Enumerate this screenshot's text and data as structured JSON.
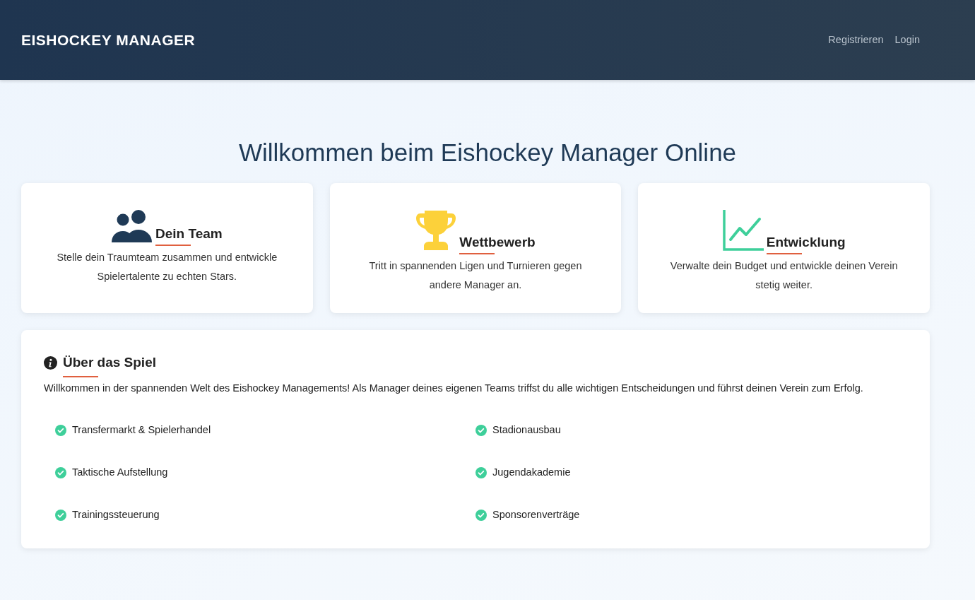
{
  "navbar": {
    "brand": "EISHOCKEY MANAGER",
    "links": [
      "Registrieren",
      "Login"
    ]
  },
  "hero": {
    "title": "Willkommen beim Eishockey Manager Online"
  },
  "features": [
    {
      "kind": "team",
      "title": "Dein Team",
      "text": "Stelle dein Traumteam zusammen und entwickle Spielertalente zu echten Stars."
    },
    {
      "kind": "trophy",
      "title": "Wettbewerb",
      "text": "Tritt in spannenden Ligen und Turnieren gegen andere Manager an."
    },
    {
      "kind": "chart",
      "title": "Entwicklung",
      "text": "Verwalte dein Budget und entwickle deinen Verein stetig weiter."
    }
  ],
  "about": {
    "title": "Über das Spiel",
    "text": "Willkommen in der spannenden Welt des Eishockey Managements! Als Manager deines eigenen Teams triffst du alle wichtigen Entscheidungen und führst deinen Verein zum Erfolg.",
    "items": [
      "Transfermarkt & Spielerhandel",
      "Stadionausbau",
      "Taktische Aufstellung",
      "Jugendakademie",
      "Trainingssteuerung",
      "Sponsorenverträge"
    ]
  }
}
